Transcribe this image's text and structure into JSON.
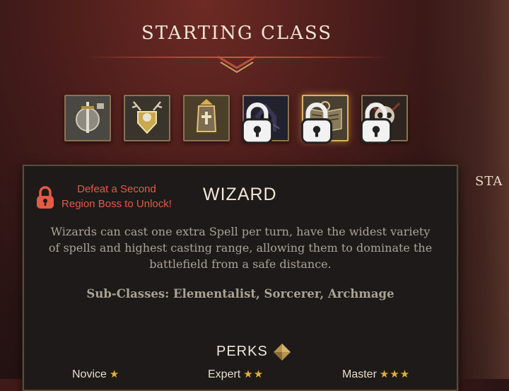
{
  "header": {
    "title": "STARTING CLASS"
  },
  "classes": [
    {
      "name": "warrior-class",
      "locked": false,
      "selected": false
    },
    {
      "name": "druid-class",
      "locked": false,
      "selected": false
    },
    {
      "name": "cleric-class",
      "locked": false,
      "selected": false
    },
    {
      "name": "rogue-class",
      "locked": true,
      "selected": false
    },
    {
      "name": "wizard-class",
      "locked": true,
      "selected": true
    },
    {
      "name": "necromancer-class",
      "locked": true,
      "selected": false
    }
  ],
  "detail": {
    "unlock_text_line1": "Defeat a Second",
    "unlock_text_line2": "Region Boss to Unlock!",
    "class_name": "WIZARD",
    "desc_line1": "Wizards can cast one extra Spell per turn, have the widest variety",
    "desc_line2": "of spells and highest casting range, allowing them to dominate the",
    "desc_line3": "battlefield from a safe distance.",
    "subclasses": "Sub-Classes: Elementalist, Sorcerer, Archmage",
    "perks_title": "PERKS",
    "tiers": [
      {
        "label": "Novice",
        "stars": "★"
      },
      {
        "label": "Expert",
        "stars": "★★"
      },
      {
        "label": "Master",
        "stars": "★★★"
      }
    ]
  },
  "side_panel": {
    "label": "STA"
  },
  "colors": {
    "accent_gold": "#e0b35a",
    "lock_red": "#e45a45",
    "panel_bg": "#1d1a19"
  }
}
